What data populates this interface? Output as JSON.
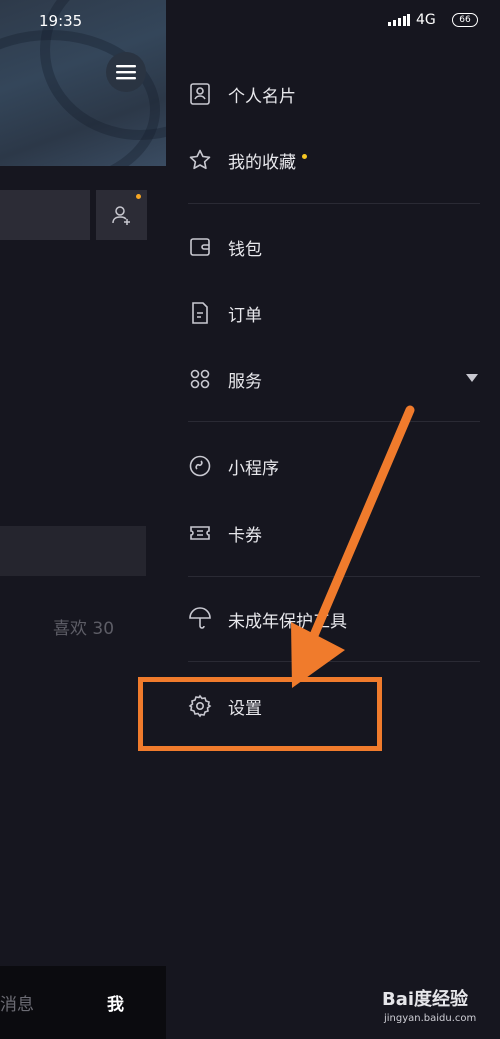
{
  "status_bar": {
    "time": "19:35",
    "network": "4G",
    "battery": "66"
  },
  "profile": {
    "likes_label": "喜欢 30"
  },
  "bottom_nav": {
    "messages": "消息",
    "me": "我"
  },
  "drawer": {
    "items": [
      {
        "label": "个人名片",
        "icon": "profile-card-icon"
      },
      {
        "label": "我的收藏",
        "icon": "star-icon"
      },
      {
        "label": "钱包",
        "icon": "wallet-icon"
      },
      {
        "label": "订单",
        "icon": "order-icon"
      },
      {
        "label": "服务",
        "icon": "grid-icon"
      },
      {
        "label": "小程序",
        "icon": "mini-program-icon"
      },
      {
        "label": "卡券",
        "icon": "coupon-icon"
      },
      {
        "label": "未成年保护工具",
        "icon": "umbrella-icon"
      },
      {
        "label": "设置",
        "icon": "gear-icon"
      }
    ]
  },
  "watermark": {
    "brand": "Bai度经验",
    "url": "jingyan.baidu.com"
  },
  "colors": {
    "annotation": "#f07b2c",
    "background": "#16161f",
    "notice_dot": "#f6c623"
  }
}
